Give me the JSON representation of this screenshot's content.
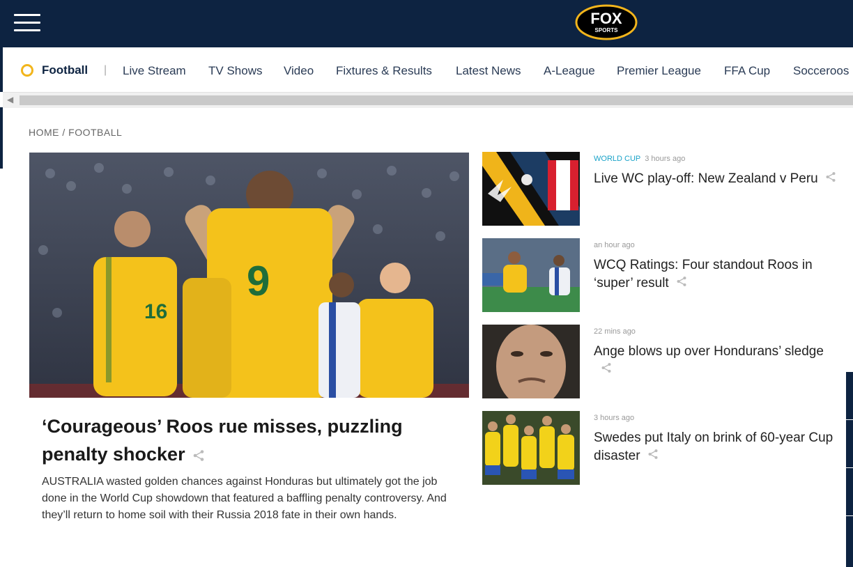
{
  "brand": {
    "logo_text": "FOX",
    "logo_sub": "SPORTS"
  },
  "subnav": {
    "active": "Football",
    "separator": "|",
    "items": [
      "Live Stream",
      "TV Shows",
      "Video",
      "Fixtures & Results",
      "Latest News",
      "A-League",
      "Premier League",
      "FFA Cup",
      "Socceroos"
    ]
  },
  "breadcrumb": "HOME / FOOTBALL",
  "lead_story": {
    "headline": "‘Courageous’ Roos rue misses, puzzling penalty shocker",
    "lede": "AUSTRALIA wasted golden chances against Honduras but ultimately got the job done in the World Cup showdown that featured a baffling penalty controversy. And they’ll return to home soil with their Russia 2018 fate in their own hands.",
    "image_jersey_numbers": [
      "16",
      "9"
    ]
  },
  "stories": [
    {
      "category": "WORLD CUP",
      "time": "3 hours ago",
      "title": "Live WC play-off: New Zealand v Peru"
    },
    {
      "category": "",
      "time": "an hour ago",
      "title": "WCQ Ratings: Four standout Roos in ‘super’ result"
    },
    {
      "category": "",
      "time": "22 mins ago",
      "title": "Ange blows up over Hondurans’ sledge"
    },
    {
      "category": "",
      "time": "3 hours ago",
      "title": "Swedes put Italy on brink of 60-year Cup disaster"
    }
  ],
  "colors": {
    "navy": "#0d2341",
    "gold": "#f2b51c",
    "accent": "#1aa3c9"
  },
  "icons": {
    "menu": "hamburger-icon",
    "share": "share-icon",
    "scroll_left": "chevron-left-icon"
  }
}
